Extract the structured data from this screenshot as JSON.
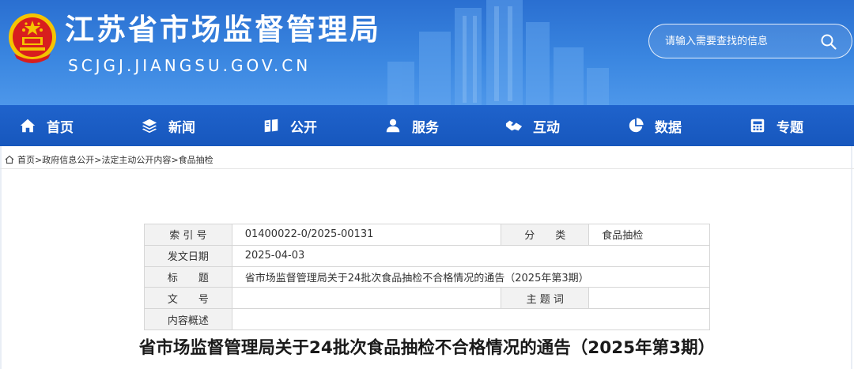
{
  "header": {
    "site_title": "江苏省市场监督管理局",
    "site_domain": "SCJGJ.JIANGSU.GOV.CN",
    "search_placeholder": "请输入需要查找的信息"
  },
  "nav": {
    "items": [
      {
        "label": "首页",
        "icon": "home-icon"
      },
      {
        "label": "新闻",
        "icon": "layers-icon"
      },
      {
        "label": "公开",
        "icon": "open-book-icon"
      },
      {
        "label": "服务",
        "icon": "user-service-icon"
      },
      {
        "label": "互动",
        "icon": "handshake-icon"
      },
      {
        "label": "数据",
        "icon": "pie-chart-icon"
      },
      {
        "label": "专题",
        "icon": "calculator-icon"
      }
    ]
  },
  "breadcrumb": {
    "items": [
      "首页",
      "政府信息公开",
      "法定主动公开内容",
      "食品抽检"
    ],
    "separator": ">"
  },
  "meta_table": {
    "index_label": "索 引 号",
    "index_value": "01400022-0/2025-00131",
    "category_label": "分　　类",
    "category_value": "食品抽检",
    "date_label": "发文日期",
    "date_value": "2025-04-03",
    "title_label": "标　　题",
    "title_value": "省市场监督管理局关于24批次食品抽检不合格情况的通告（2025年第3期）",
    "docnum_label": "文　　号",
    "docnum_value": "",
    "keywords_label": "主 题 词",
    "keywords_value": "",
    "summary_label": "内容概述",
    "summary_value": ""
  },
  "article": {
    "title": "省市场监督管理局关于24批次食品抽检不合格情况的通告（2025年第3期）"
  },
  "colors": {
    "header_blue": "#3a86e0",
    "nav_blue": "#1f63cc",
    "emblem_red": "#d81e1e",
    "emblem_gold": "#f5c400",
    "label_bg": "#f2f2f2"
  }
}
